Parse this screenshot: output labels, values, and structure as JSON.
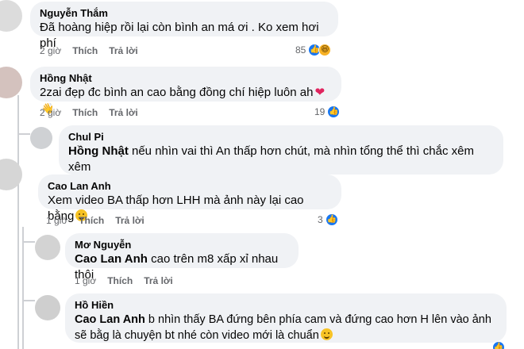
{
  "comments": [
    {
      "author": "Nguyễn Thắm",
      "text": "Đã hoàng hiệp rồi lại còn bình an má ơi . Ko xem hơi phí",
      "time": "2 giờ",
      "like_label": "Thích",
      "reply_label": "Trả lời",
      "reaction_count": "85",
      "reactions": [
        "like-icon",
        "haha-icon"
      ]
    },
    {
      "author": "Hồng Nhật",
      "text": "2zai đẹp đc bình an cao bằng đồng chí hiệp luôn ah",
      "time": "2 giờ",
      "like_label": "Thích",
      "reply_label": "Trả lời",
      "reaction_count": "19",
      "reactions": [
        "like-icon"
      ]
    },
    {
      "author": "Chul Pi",
      "mention": "Hồng Nhật",
      "text": "nếu nhìn vai thì An thấp hơn chút, mà nhìn tổng thể thì chắc xêm xêm"
    },
    {
      "author": "Cao Lan Anh",
      "text": "Xem video BA thấp hơn LHH mà ảnh này lại cao bằng",
      "time": "1 giờ",
      "like_label": "Thích",
      "reply_label": "Trả lời",
      "reaction_count": "3",
      "reactions": [
        "like-icon"
      ]
    },
    {
      "author": "Mơ Nguyễn",
      "mention": "Cao Lan Anh",
      "text": "cao trên m8 xấp xỉ nhau thôi",
      "time": "1 giờ",
      "like_label": "Thích",
      "reply_label": "Trả lời"
    },
    {
      "author": "Hồ Hiền",
      "mention": "Cao Lan Anh",
      "text": "b nhìn thấy BA đứng bên phía cam và đứng cao hơn H lên vào ảnh sẽ bằg là chuyện bt nhé còn video mới là chuẩn"
    }
  ],
  "colors": {
    "bubble": "#f0f2f5",
    "meta_text": "#65676b",
    "like_blue": "#1877f2",
    "thread_line": "#ced0d4"
  }
}
